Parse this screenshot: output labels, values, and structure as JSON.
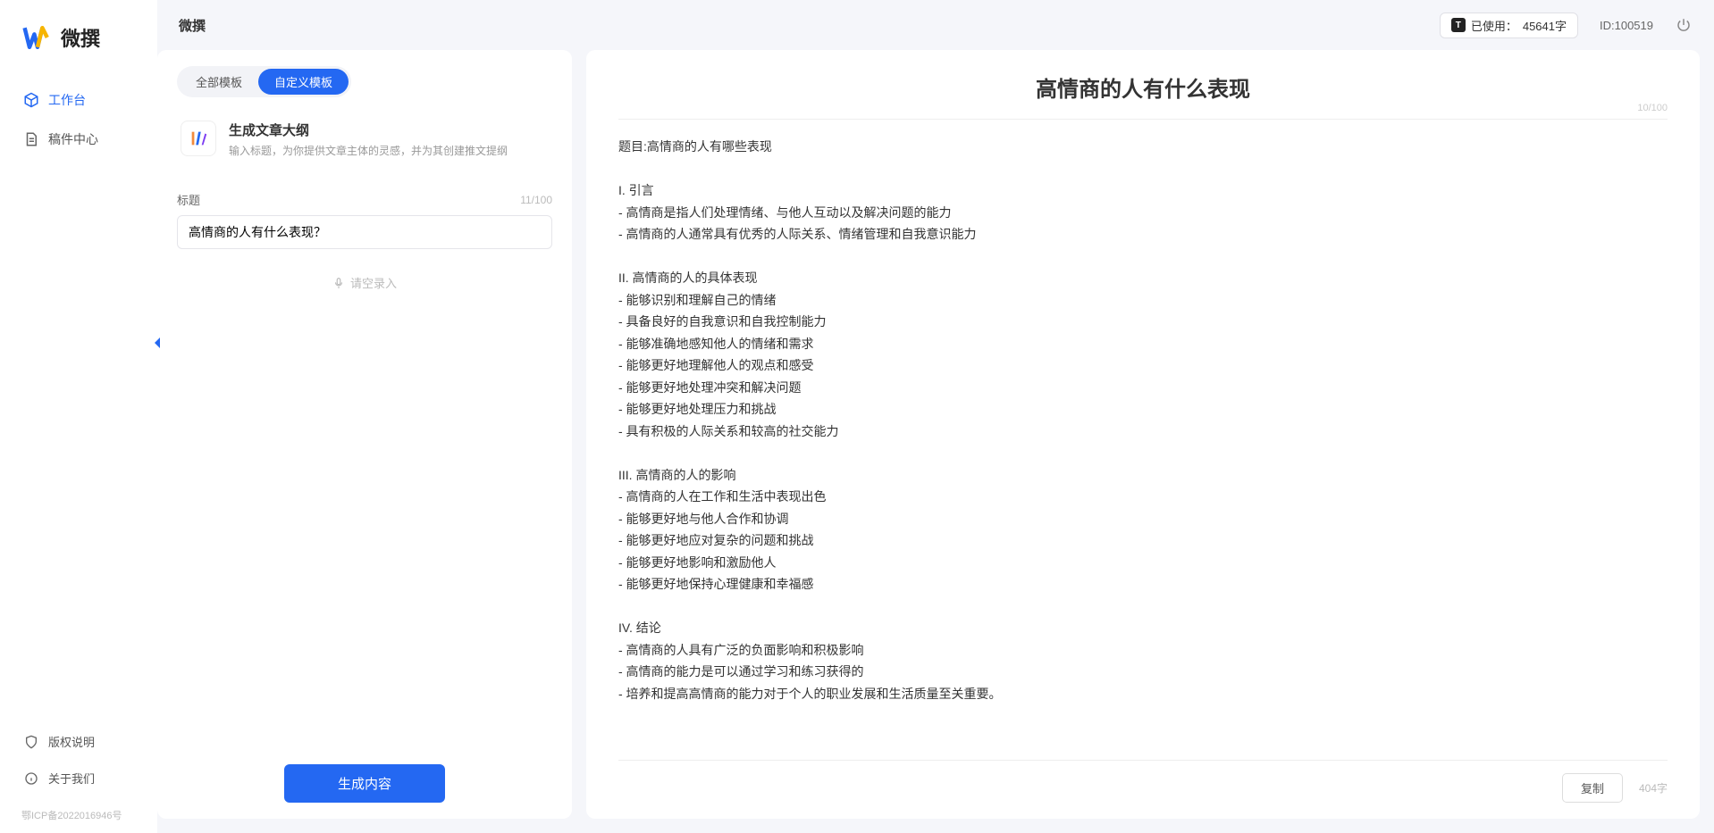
{
  "app": {
    "logoText": "微撰"
  },
  "sidebar": {
    "nav": [
      {
        "label": "工作台",
        "active": true
      },
      {
        "label": "稿件中心",
        "active": false
      }
    ],
    "bottom": [
      {
        "label": "版权说明"
      },
      {
        "label": "关于我们"
      }
    ],
    "icp": "鄂ICP备2022016946号"
  },
  "topbar": {
    "title": "微撰",
    "usagePrefix": "已使用：",
    "usageValue": "45641字",
    "userIdLabel": "ID:100519"
  },
  "left": {
    "tabs": [
      {
        "label": "全部模板",
        "active": false
      },
      {
        "label": "自定义模板",
        "active": true
      }
    ],
    "template": {
      "name": "生成文章大纲",
      "desc": "输入标题，为你提供文章主体的灵感，并为其创建推文提纲"
    },
    "field": {
      "label": "标题",
      "counter": "11/100",
      "value": "高情商的人有什么表现？"
    },
    "placeholderLine": "请空录入",
    "generateLabel": "生成内容"
  },
  "right": {
    "title": "高情商的人有什么表现",
    "titleCounter": "10/100",
    "body": "题目:高情商的人有哪些表现\n\nI. 引言\n- 高情商是指人们处理情绪、与他人互动以及解决问题的能力\n- 高情商的人通常具有优秀的人际关系、情绪管理和自我意识能力\n\nII. 高情商的人的具体表现\n- 能够识别和理解自己的情绪\n- 具备良好的自我意识和自我控制能力\n- 能够准确地感知他人的情绪和需求\n- 能够更好地理解他人的观点和感受\n- 能够更好地处理冲突和解决问题\n- 能够更好地处理压力和挑战\n- 具有积极的人际关系和较高的社交能力\n\nIII. 高情商的人的影响\n- 高情商的人在工作和生活中表现出色\n- 能够更好地与他人合作和协调\n- 能够更好地应对复杂的问题和挑战\n- 能够更好地影响和激励他人\n- 能够更好地保持心理健康和幸福感\n\nIV. 结论\n- 高情商的人具有广泛的负面影响和积极影响\n- 高情商的能力是可以通过学习和练习获得的\n- 培养和提高高情商的能力对于个人的职业发展和生活质量至关重要。",
    "copyLabel": "复制",
    "charCount": "404字"
  }
}
